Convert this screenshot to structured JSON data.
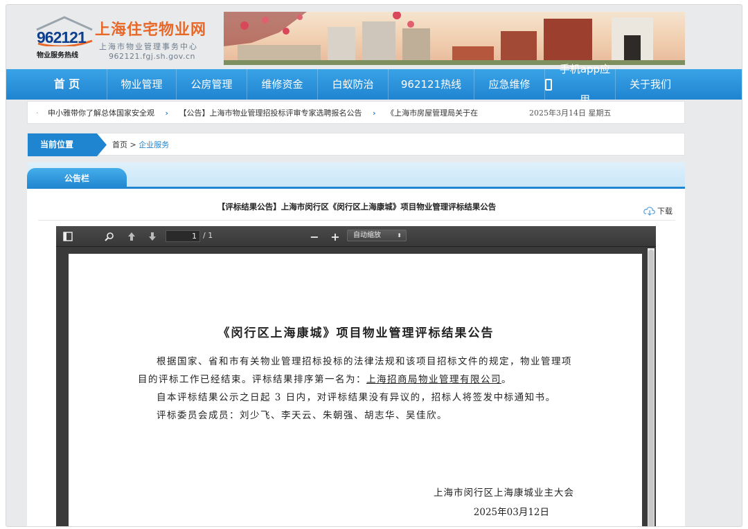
{
  "header": {
    "logo_number": "962121",
    "logo_tagline": "物业服务热线",
    "site_title": "上海住宅物业网",
    "site_subtitle": "上海市物业管理事务中心",
    "site_domain": "962121.fgj.sh.gov.cn"
  },
  "nav": {
    "items": [
      "首 页",
      "物业管理",
      "公房管理",
      "维修资金",
      "白蚁防治",
      "962121热线",
      "应急维修",
      "手机app应用",
      "关于我们"
    ]
  },
  "ticker": {
    "items": [
      "申小雅带你了解总体国家安全观",
      "【公告】上海市物业管理招投标评审专家选聘报名公告",
      "《上海市房屋管理局关于在"
    ],
    "date": "2025年3月14日 星期五"
  },
  "location": {
    "label": "当前位置",
    "home": "首页",
    "separator": ">",
    "current": "企业服务"
  },
  "board": {
    "tab_label": "公告栏",
    "article_title": "【评标结果公告】上海市闵行区《闵行区上海康城》项目物业管理评标结果公告",
    "download_label": "下载"
  },
  "pdf_viewer": {
    "page_current": "1",
    "page_total": "/ 1",
    "zoom": "自动缩放",
    "icons": [
      "sidebar-toggle-icon",
      "search-icon",
      "previous-page-icon",
      "next-page-icon",
      "zoom-out-icon",
      "zoom-in-icon"
    ]
  },
  "document": {
    "title": "《闵行区上海康城》项目物业管理评标结果公告",
    "para1_pre": "根据国家、省和市有关物业管理招标投标的法律法规和该项目招标文件的规定，物业管理项目的评标工作已经结束。评标结果排序第一名为：",
    "para1_winner": "上海招商局物业管理有限公司",
    "para1_post": "。",
    "para2": "自本评标结果公示之日起 3 日内，对评标结果没有异议的，招标人将签发中标通知书。",
    "para3": "评标委员会成员：刘少飞、李天云、朱朝强、胡志华、吴佳欣。",
    "signer": "上海市闵行区上海康城业主大会",
    "sign_date": "2025年03月12日"
  },
  "colors": {
    "nav_blue": "#1f85d0",
    "brand_orange": "#e8682a",
    "logo_blue": "#0d3f8c"
  }
}
